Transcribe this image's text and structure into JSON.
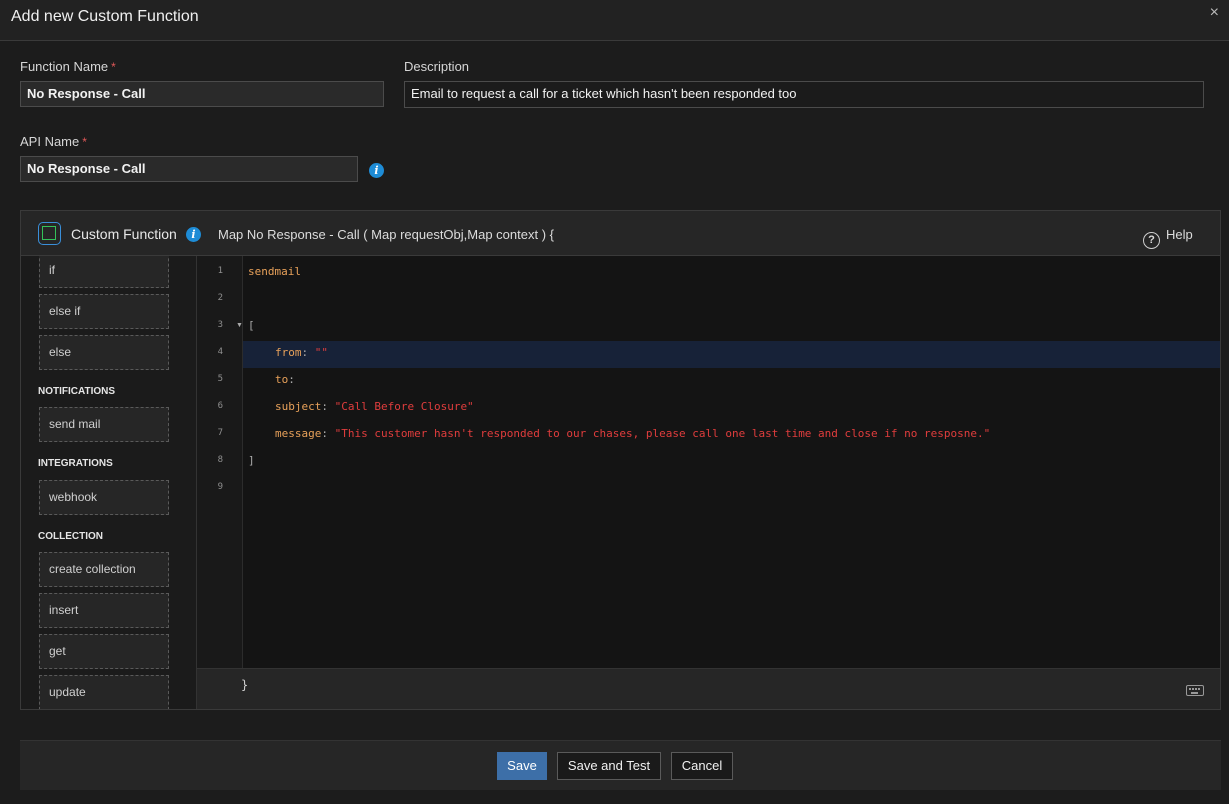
{
  "dialog": {
    "title": "Add new Custom Function",
    "close_glyph": "×"
  },
  "form": {
    "function_name": {
      "label": "Function Name",
      "required_mark": "*",
      "value": "No Response - Call"
    },
    "description": {
      "label": "Description",
      "value": "Email to request a call for a ticket which hasn't been responded too"
    },
    "api_name": {
      "label": "API Name",
      "required_mark": "*",
      "value": "No Response - Call"
    },
    "info_glyph": "i"
  },
  "custom_function": {
    "title": "Custom Function",
    "signature": "Map No Response - Call ( Map requestObj,Map context ) {",
    "help_label": "Help",
    "help_glyph": "?",
    "closing_brace": "}"
  },
  "sidebar": {
    "items_top": [
      "if",
      "else if",
      "else"
    ],
    "sections": [
      {
        "title": "NOTIFICATIONS",
        "items": [
          "send mail"
        ]
      },
      {
        "title": "INTEGRATIONS",
        "items": [
          "webhook"
        ]
      },
      {
        "title": "COLLECTION",
        "items": [
          "create collection",
          "insert",
          "get",
          "update"
        ]
      }
    ]
  },
  "editor": {
    "line_numbers": [
      "1",
      "2",
      "3",
      "4",
      "5",
      "6",
      "7",
      "8",
      "9"
    ],
    "fold_marker": "▼",
    "lines": {
      "l1": "sendmail",
      "l3": "[",
      "l4_key": "from",
      "l4_colon": ":",
      "l4_val": "\"\"",
      "l5_key": "to",
      "l5_colon": ":",
      "l6_key": "subject",
      "l6_colon": ":",
      "l6_val": "\"Call Before Closure\"",
      "l7_key": "message",
      "l7_colon": ":",
      "l7_val": "\"This customer hasn't responded to our chases, please call one last time and close if no resposne.\"",
      "l8": "]"
    }
  },
  "actions": {
    "save": "Save",
    "save_and_test": "Save and Test",
    "cancel": "Cancel"
  },
  "colors": {
    "accent_blue": "#3d6fa8",
    "info_blue": "#1e8cd6",
    "string_red": "#e03d3d",
    "key_orange": "#e8a15a",
    "logo_green": "#34c25a"
  },
  "icons": [
    "close-icon",
    "info-icon",
    "custom-function-logo-icon",
    "help-icon",
    "keyboard-icon",
    "fold-arrow-icon"
  ]
}
